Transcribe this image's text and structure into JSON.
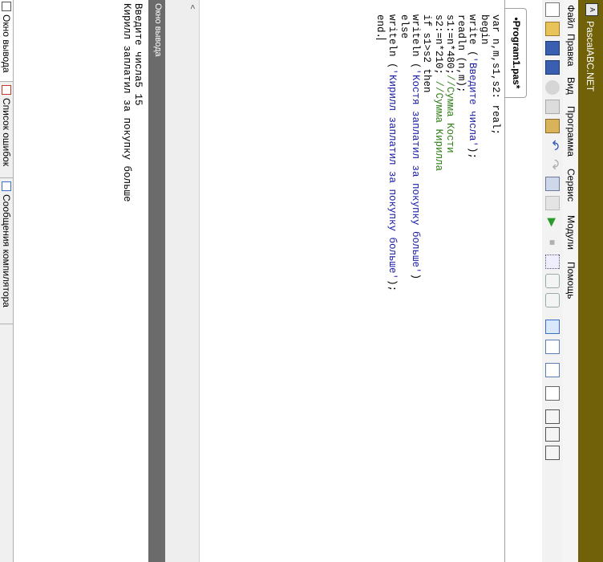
{
  "window": {
    "title": "PascalABC.NET",
    "icon": "pascal-app-icon",
    "title_bar_color": "#716209"
  },
  "menu": [
    {
      "label": "Файл"
    },
    {
      "label": "Правка"
    },
    {
      "label": "Вид"
    },
    {
      "label": "Программа"
    },
    {
      "label": "Сервис"
    },
    {
      "label": "Модули"
    },
    {
      "label": "Помощь"
    }
  ],
  "toolbar": [
    "new-file-icon",
    "open-folder-icon",
    "save-icon",
    "save-all-icon",
    "cut-icon",
    "copy-icon",
    "paste-icon",
    "undo-icon",
    "redo-icon",
    "compile-icon",
    "rebuild-icon",
    "run-icon",
    "stop-icon",
    "debug-icon",
    "step-over-icon",
    "step-into-icon",
    "toggle-panel-icon",
    "breakpoint-icon",
    "watch-icon",
    "output-icon",
    "format-icon",
    "indent-icon",
    "outdent-icon"
  ],
  "tab": {
    "label": "•Program1.pas*"
  },
  "code": {
    "lines": [
      [
        {
          "t": "var n,m,s1,s2: real;",
          "c": "kw"
        }
      ],
      [
        {
          "t": "begin",
          "c": "kw"
        }
      ],
      [
        {
          "t": "write (",
          "c": "kw"
        },
        {
          "t": "'Введите числа'",
          "c": "str"
        },
        {
          "t": ");",
          "c": "kw"
        }
      ],
      [
        {
          "t": "readln (n,m);",
          "c": "kw"
        }
      ],
      [
        {
          "t": "s1:=n*480;",
          "c": "kw"
        },
        {
          "t": "//Сумма Кости",
          "c": "cm"
        }
      ],
      [
        {
          "t": "s2:=n*210; ",
          "c": "kw"
        },
        {
          "t": "//Сумма Кирилла",
          "c": "cm"
        }
      ],
      [
        {
          "t": "if s1>s2 then",
          "c": "kw"
        }
      ],
      [
        {
          "t": "writeln (",
          "c": "kw"
        },
        {
          "t": "'Костя заплатил за покупку больше'",
          "c": "str"
        },
        {
          "t": ")",
          "c": "kw"
        }
      ],
      [
        {
          "t": "else",
          "c": "kw"
        }
      ],
      [
        {
          "t": "writeln (",
          "c": "kw"
        },
        {
          "t": "'Кирилл заплатил за покупку больше'",
          "c": "str"
        },
        {
          "t": ");",
          "c": "kw"
        }
      ],
      [
        {
          "t": "end.",
          "c": "kw"
        }
      ]
    ]
  },
  "output": {
    "header": "Окно вывода",
    "lines": [
      "Введите числа5 15",
      "Кирилл заплатил за покупку больше"
    ]
  },
  "bottom_tabs": [
    {
      "label": "Окно вывода",
      "icon": "output-window-icon"
    },
    {
      "label": "Список ошибок",
      "icon": "error-list-icon"
    },
    {
      "label": "Сообщения компилятора",
      "icon": "compiler-messages-icon"
    }
  ],
  "colors": {
    "accent": "#716209",
    "string": "#1a1aa6",
    "comment": "#2e7d16",
    "output_header": "#6b6b6b"
  }
}
